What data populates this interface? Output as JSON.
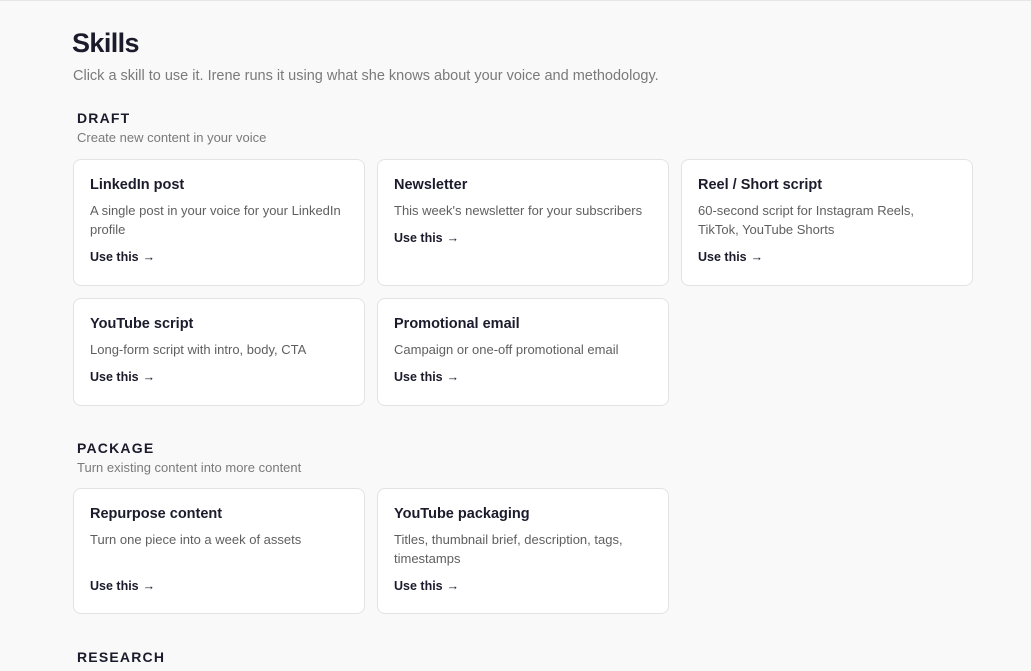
{
  "page": {
    "title": "Skills",
    "subtitle": "Click a skill to use it. Irene runs it using what she knows about your voice and methodology."
  },
  "sections": [
    {
      "title": "DRAFT",
      "description": "Create new content in your voice",
      "cards": [
        {
          "title": "LinkedIn post",
          "description": "A single post in your voice for your LinkedIn profile",
          "action": "Use this"
        },
        {
          "title": "Newsletter",
          "description": "This week's newsletter for your subscribers",
          "action": "Use this"
        },
        {
          "title": "Reel / Short script",
          "description": "60-second script for Instagram Reels, TikTok, YouTube Shorts",
          "action": "Use this"
        },
        {
          "title": "YouTube script",
          "description": "Long-form script with intro, body, CTA",
          "action": "Use this"
        },
        {
          "title": "Promotional email",
          "description": "Campaign or one-off promotional email",
          "action": "Use this"
        }
      ]
    },
    {
      "title": "PACKAGE",
      "description": "Turn existing content into more content",
      "cards": [
        {
          "title": "Repurpose content",
          "description": "Turn one piece into a week of assets",
          "action": "Use this"
        },
        {
          "title": "YouTube packaging",
          "description": "Titles, thumbnail brief, description, tags, timestamps",
          "action": "Use this"
        }
      ]
    },
    {
      "title": "RESEARCH",
      "description": "",
      "cards": []
    }
  ],
  "icons": {
    "action_arrow": "arrow-right-icon"
  },
  "arrow_glyph": "→"
}
